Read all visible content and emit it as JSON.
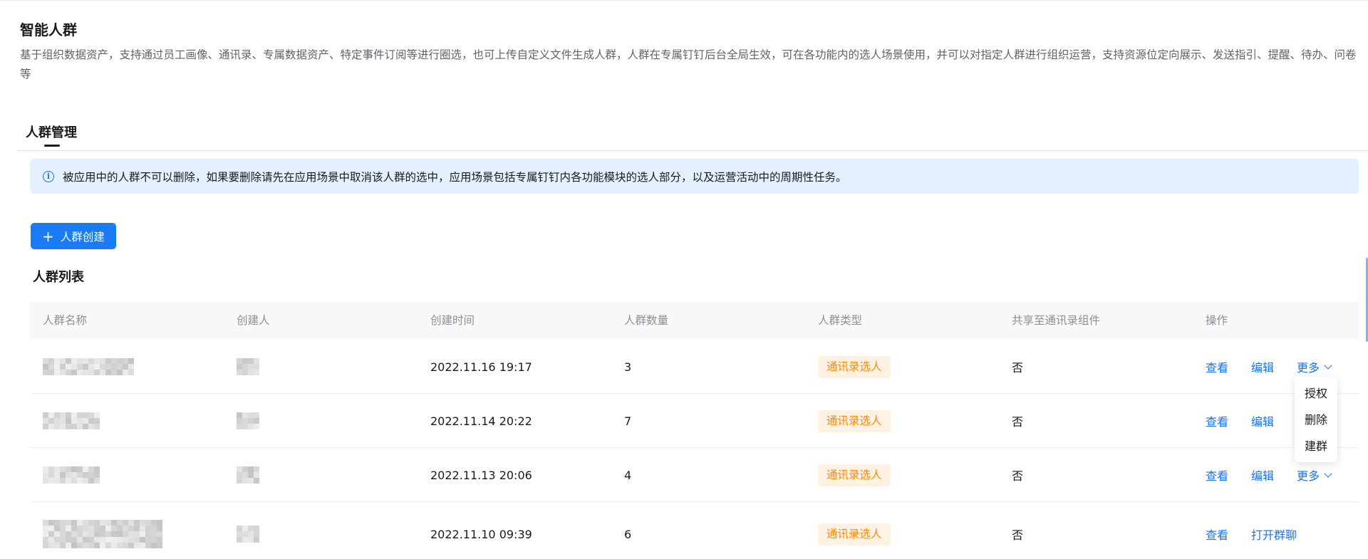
{
  "page": {
    "title": "智能人群",
    "description": "基于组织数据资产，支持通过员工画像、通讯录、专属数据资产、特定事件订阅等进行圈选，也可上传自定义文件生成人群，人群在专属钉钉后台全局生效，可在各功能内的选人场景使用，并可以对指定人群进行组织运营，支持资源位定向展示、发送指引、提醒、待办、问卷等"
  },
  "tabs": [
    {
      "label": "人群管理",
      "active": true
    }
  ],
  "notice": {
    "icon": "info-circle-icon",
    "text": "被应用中的人群不可以删除，如果要删除请先在应用场景中取消该人群的选中，应用场景包括专属钉钉内各功能模块的选人部分，以及运营活动中的周期性任务。"
  },
  "create_button": {
    "icon": "plus-icon",
    "label": "人群创建"
  },
  "list": {
    "title": "人群列表",
    "columns": [
      "人群名称",
      "创建人",
      "创建时间",
      "人群数量",
      "人群类型",
      "共享至通讯录组件",
      "操作"
    ],
    "rows": [
      {
        "created_at": "2022.11.16 19:17",
        "count": "3",
        "type": "通讯录选人",
        "shared": "否",
        "actions": [
          "查看",
          "编辑"
        ],
        "more": "更多"
      },
      {
        "created_at": "2022.11.14 20:22",
        "count": "7",
        "type": "通讯录选人",
        "shared": "否",
        "actions": [
          "查看",
          "编辑"
        ],
        "more": ""
      },
      {
        "created_at": "2022.11.13 20:06",
        "count": "4",
        "type": "通讯录选人",
        "shared": "否",
        "actions": [
          "查看",
          "编辑"
        ],
        "more": "更多"
      },
      {
        "created_at": "2022.11.10 09:39",
        "count": "6",
        "type": "通讯录选人",
        "shared": "否",
        "actions": [
          "查看",
          "打开群聊"
        ],
        "more": ""
      }
    ]
  },
  "more_menu": {
    "items": [
      "授权",
      "删除",
      "建群"
    ]
  },
  "colors": {
    "primary": "#1a7cf5",
    "link": "#1a73e8",
    "tag_text": "#ff8800",
    "tag_bg": "#fff2e3",
    "notice_bg": "#e4f0fd"
  }
}
